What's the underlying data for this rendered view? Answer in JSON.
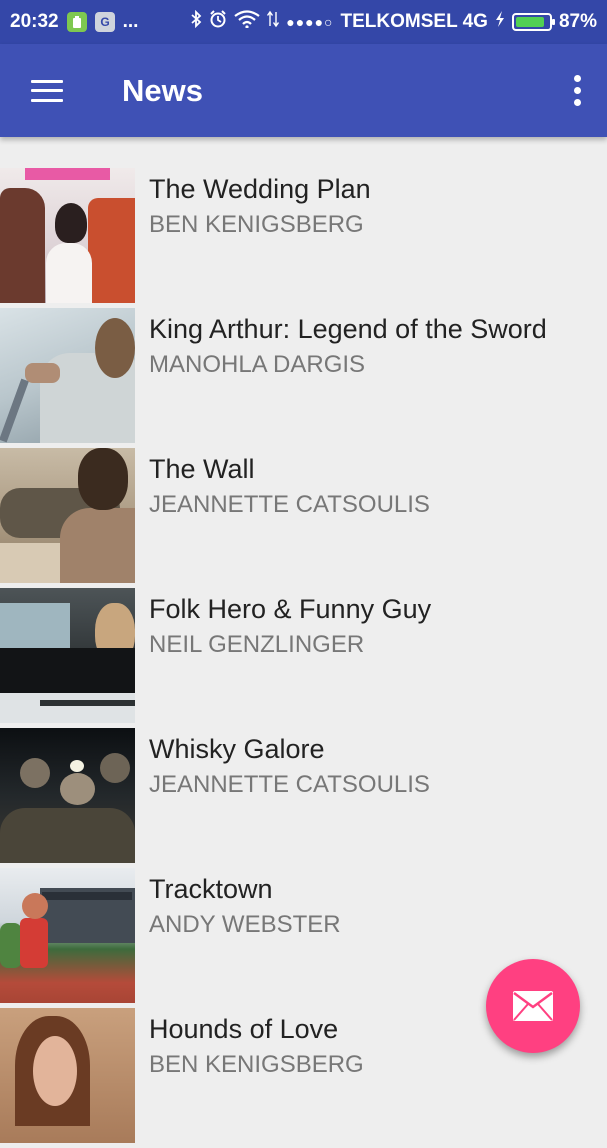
{
  "status_bar": {
    "time": "20:32",
    "carrier": "TELKOMSEL 4G",
    "battery_percent": "87%",
    "battery_level": 0.87,
    "signal_dots": "●●●●○",
    "more_indicator": "...",
    "icons": [
      "battery-saver-icon",
      "google-icon",
      "bluetooth-icon",
      "alarm-icon",
      "wifi-icon",
      "data-arrows-icon",
      "charging-icon",
      "battery-icon"
    ]
  },
  "app_bar": {
    "title": "News",
    "color": "#3f51b5",
    "left_icon": "menu-icon",
    "right_icon": "more-vert-icon"
  },
  "news": [
    {
      "title": "The Wedding Plan",
      "author": "BEN KENIGSBERG"
    },
    {
      "title": "King Arthur: Legend of the Sword",
      "author": "MANOHLA DARGIS"
    },
    {
      "title": "The Wall",
      "author": "JEANNETTE CATSOULIS"
    },
    {
      "title": "Folk Hero & Funny Guy",
      "author": "NEIL GENZLINGER"
    },
    {
      "title": "Whisky Galore",
      "author": "JEANNETTE CATSOULIS"
    },
    {
      "title": "Tracktown",
      "author": "ANDY WEBSTER"
    },
    {
      "title": "Hounds of Love",
      "author": "BEN KENIGSBERG"
    }
  ],
  "fab": {
    "icon": "mail-icon",
    "color": "#ff4081"
  }
}
